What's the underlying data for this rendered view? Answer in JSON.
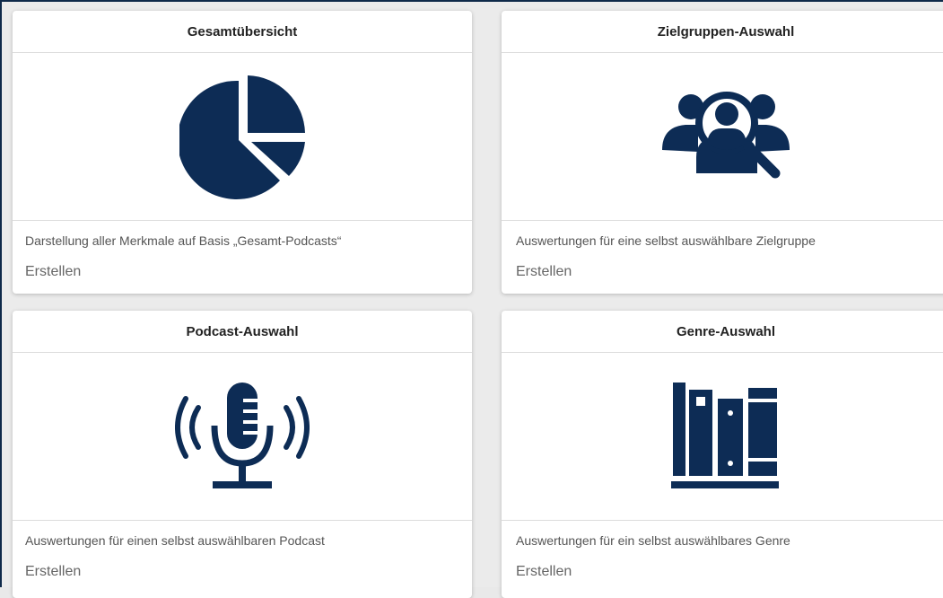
{
  "colors": {
    "icon": "#0d2c55",
    "background": "#ebebeb",
    "card": "#ffffff"
  },
  "cards": [
    {
      "title": "Gesamtübersicht",
      "icon": "pie-chart-icon",
      "description": "Darstellung aller Merkmale auf Basis „Gesamt-Podcasts“",
      "action": "Erstellen"
    },
    {
      "title": "Zielgruppen-Auswahl",
      "icon": "audience-search-icon",
      "description": "Auswertungen für eine selbst auswählbare Zielgruppe",
      "action": "Erstellen"
    },
    {
      "title": "Podcast-Auswahl",
      "icon": "microphone-icon",
      "description": "Auswertungen für einen selbst auswählbaren Podcast",
      "action": "Erstellen"
    },
    {
      "title": "Genre-Auswahl",
      "icon": "books-icon",
      "description": "Auswertungen für ein selbst auswählbares Genre",
      "action": "Erstellen"
    }
  ]
}
